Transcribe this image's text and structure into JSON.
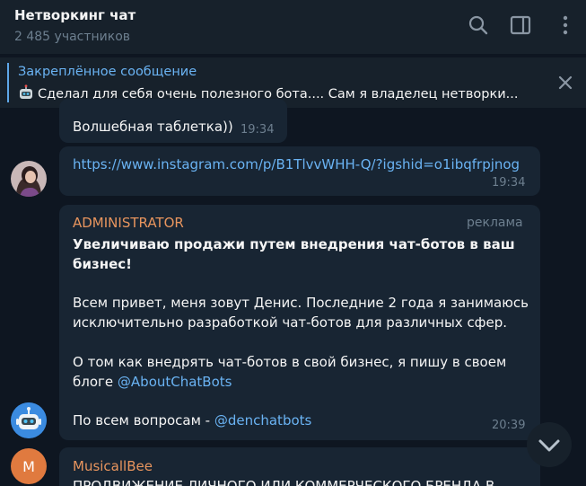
{
  "header": {
    "title": "Нетворкинг чат",
    "subtitle": "2 485 участников",
    "icons": [
      "search-icon",
      "sidebar-icon",
      "more-icon"
    ]
  },
  "pinned": {
    "title": "Закреплённое сообщение",
    "text": "Сделал для себя очень полезного бота....  Сам я владелец нетворки..."
  },
  "messages": [
    {
      "text": "Волшебная таблетка))",
      "time": "19:34"
    },
    {
      "link": "https://www.instagram.com/p/B1TlvvWHH-Q/?igshid=o1ibqfrpjnog",
      "time": "19:34"
    },
    {
      "sender": "ADMINISTRATOR",
      "badge": "реклама",
      "title_line1": "Увеличиваю продажи путем внедрения чат-ботов в ваш",
      "title_line2": "бизнес!",
      "p1_line1": "Всем привет, меня зовут Денис. Последние 2 года я занимаюсь",
      "p1_line2": "исключительно разработкой чат-ботов для различных сфер.",
      "p2_line1": "О том как внедрять чат-ботов в свой бизнес, я пишу в своем",
      "p2_line2_prefix": "блоге ",
      "p2_link": "@AboutChatBots",
      "p3_prefix": "По всем вопросам - ",
      "p3_link": "@denchatbots",
      "time": "20:39"
    },
    {
      "sender": "MusicallBee",
      "avatar_letter": "M",
      "text": "ПРОДВИЖЕНИЕ ЛИЧНОГО ИЛИ КОММЕРЧЕСКОГО БРЕНДА В"
    }
  ],
  "colors": {
    "background": "#0e1621",
    "panel": "#17212b",
    "bubble": "#182533",
    "accent": "#6ab3f3",
    "sender_admin": "#e8955e",
    "sender_musicall": "#e8955e",
    "avatar_musicall": "#e07a3f"
  }
}
